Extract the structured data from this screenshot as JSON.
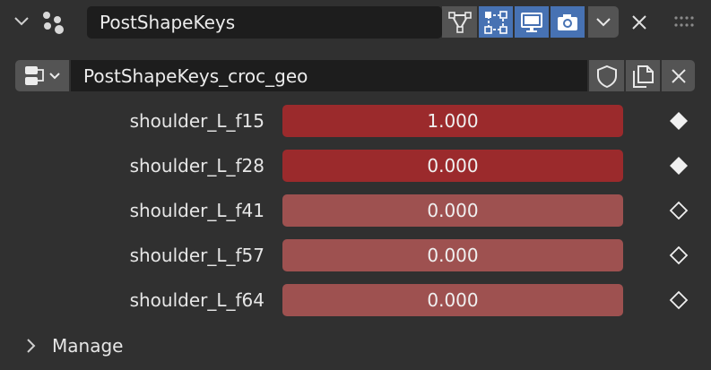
{
  "header": {
    "collapse_icon": "chevron-down-icon",
    "modifier_icon": "modifier-dots-icon",
    "modifier_name": "PostShapeKeys",
    "toggles": [
      {
        "name": "edit-cage",
        "icon": "vertex-triangle-icon",
        "active": false
      },
      {
        "name": "edit-mode",
        "icon": "edit-mode-icon",
        "active": true
      },
      {
        "name": "viewport",
        "icon": "monitor-icon",
        "active": true
      },
      {
        "name": "render",
        "icon": "camera-icon",
        "active": true
      }
    ],
    "dropdown_icon": "chevron-down-icon",
    "close_icon": "close-icon",
    "drag_icon": "drag-grip-icon"
  },
  "datablock": {
    "browse_icon": "shape-keys-icon",
    "name": "PostShapeKeys_croc_geo",
    "fake_user_icon": "shield-icon",
    "duplicate_icon": "duplicate-icon",
    "unlink_icon": "close-icon"
  },
  "shape_keys": [
    {
      "label": "shoulder_L_f15",
      "value": "1.000",
      "state": "keyed",
      "keyframe": "filled"
    },
    {
      "label": "shoulder_L_f28",
      "value": "0.000",
      "state": "keyed",
      "keyframe": "filled"
    },
    {
      "label": "shoulder_L_f41",
      "value": "0.000",
      "state": "anim",
      "keyframe": "hollow"
    },
    {
      "label": "shoulder_L_f57",
      "value": "0.000",
      "state": "anim",
      "keyframe": "hollow"
    },
    {
      "label": "shoulder_L_f64",
      "value": "0.000",
      "state": "anim",
      "keyframe": "hollow"
    }
  ],
  "colors": {
    "keyed": "#9b2a2c",
    "animated": "#9e5150",
    "active_toggle": "#4772b3"
  },
  "manage": {
    "label": "Manage",
    "icon": "chevron-right-icon"
  }
}
